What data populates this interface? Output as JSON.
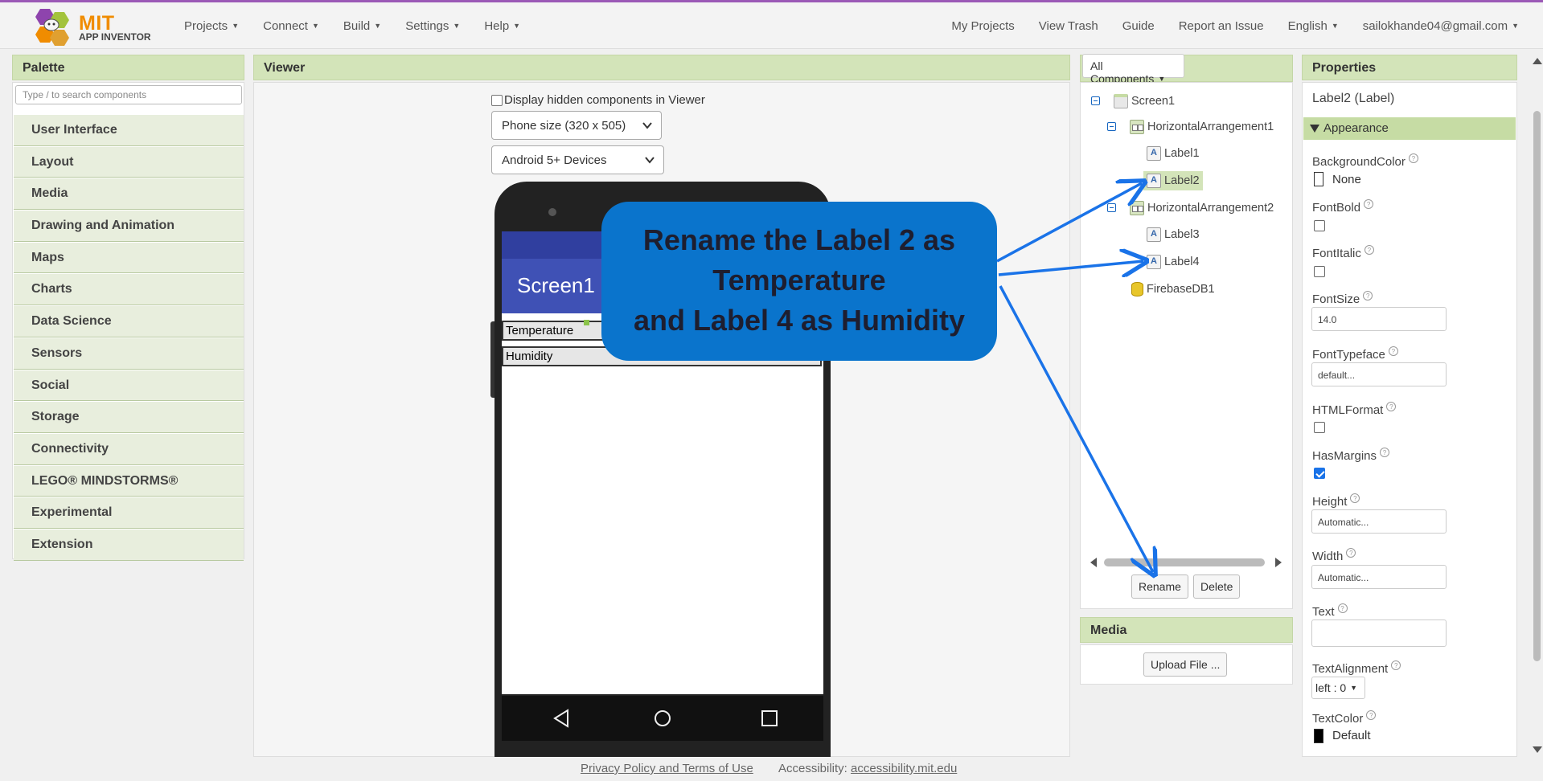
{
  "header": {
    "logo_text": "MIT",
    "logo_subtext": "APP INVENTOR",
    "nav_left": [
      "Projects",
      "Connect",
      "Build",
      "Settings",
      "Help"
    ],
    "nav_right": [
      "My Projects",
      "View Trash",
      "Guide",
      "Report an Issue",
      "English",
      "sailokhande04@gmail.com"
    ],
    "accent_color": "#9b59b6"
  },
  "palette": {
    "title": "Palette",
    "search_placeholder": "Type / to search components",
    "categories": [
      "User Interface",
      "Layout",
      "Media",
      "Drawing and Animation",
      "Maps",
      "Charts",
      "Data Science",
      "Sensors",
      "Social",
      "Storage",
      "Connectivity",
      "LEGO® MINDSTORMS®",
      "Experimental",
      "Extension"
    ]
  },
  "viewer": {
    "title": "Viewer",
    "hidden_checkbox_label": "Display hidden components in Viewer",
    "size_select": "Phone size (320 x 505)",
    "device_select": "Android 5+ Devices",
    "screen_title": "Screen1",
    "label_texts": [
      "Temperature",
      "Humidity"
    ]
  },
  "callout": {
    "lines": [
      "Rename the Label 2 as",
      "Temperature",
      "and Label 4 as Humidity"
    ],
    "color": "#0a74cc"
  },
  "components": {
    "filter_button": "All Components",
    "tree": [
      {
        "name": "Screen1",
        "icon": "screen-icon"
      },
      {
        "name": "HorizontalArrangement1",
        "icon": "horizontal-arrangement-icon"
      },
      {
        "name": "Label1",
        "icon": "label-icon"
      },
      {
        "name": "Label2",
        "icon": "label-icon",
        "selected": true
      },
      {
        "name": "HorizontalArrangement2",
        "icon": "horizontal-arrangement-icon"
      },
      {
        "name": "Label3",
        "icon": "label-icon"
      },
      {
        "name": "Label4",
        "icon": "label-icon"
      },
      {
        "name": "FirebaseDB1",
        "icon": "database-icon"
      }
    ],
    "rename_button": "Rename",
    "delete_button": "Delete"
  },
  "media": {
    "title": "Media",
    "upload_button": "Upload File ..."
  },
  "properties": {
    "title": "Properties",
    "subtitle": "Label2 (Label)",
    "section": "Appearance",
    "background_color": {
      "label": "BackgroundColor",
      "value": "None"
    },
    "font_bold": {
      "label": "FontBold",
      "checked": false
    },
    "font_italic": {
      "label": "FontItalic",
      "checked": false
    },
    "font_size": {
      "label": "FontSize",
      "value": "14.0"
    },
    "font_typeface": {
      "label": "FontTypeface",
      "value": "default..."
    },
    "html_format": {
      "label": "HTMLFormat",
      "checked": false
    },
    "has_margins": {
      "label": "HasMargins",
      "checked": true
    },
    "height": {
      "label": "Height",
      "value": "Automatic..."
    },
    "width": {
      "label": "Width",
      "value": "Automatic..."
    },
    "text": {
      "label": "Text",
      "value": ""
    },
    "text_alignment": {
      "label": "TextAlignment",
      "value": "left : 0"
    },
    "text_color": {
      "label": "TextColor",
      "value": "Default"
    },
    "help_mark": "?"
  },
  "footer": {
    "privacy": "Privacy Policy and Terms of Use",
    "accessibility_label": "Accessibility:",
    "accessibility_link": "accessibility.mit.edu"
  }
}
